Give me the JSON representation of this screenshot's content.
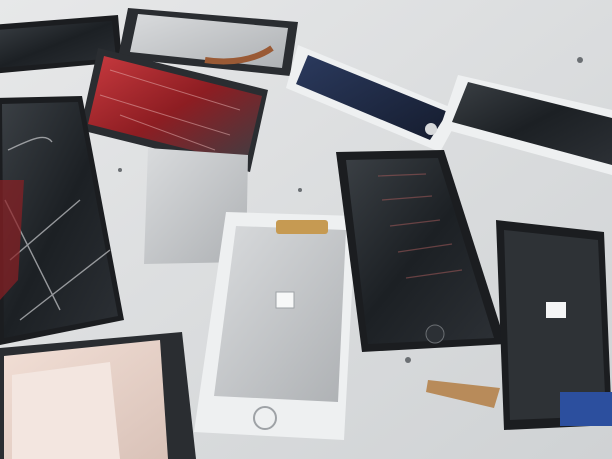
{
  "colors": {
    "table": "#dcdedf",
    "table_shadow": "#b9bcbe",
    "glass_dark": "#1f2326",
    "glass_blue": "#23304a",
    "glass_red": "#a4262b",
    "panel_silver": "#c9cbcd",
    "frame_white": "#eef0f1",
    "frame_black": "#1b1d20",
    "backplate": "#d7d9db",
    "cable_gold": "#c69a52",
    "cable_blue": "#2c4f9e",
    "cardboard": "#b88b5a"
  }
}
